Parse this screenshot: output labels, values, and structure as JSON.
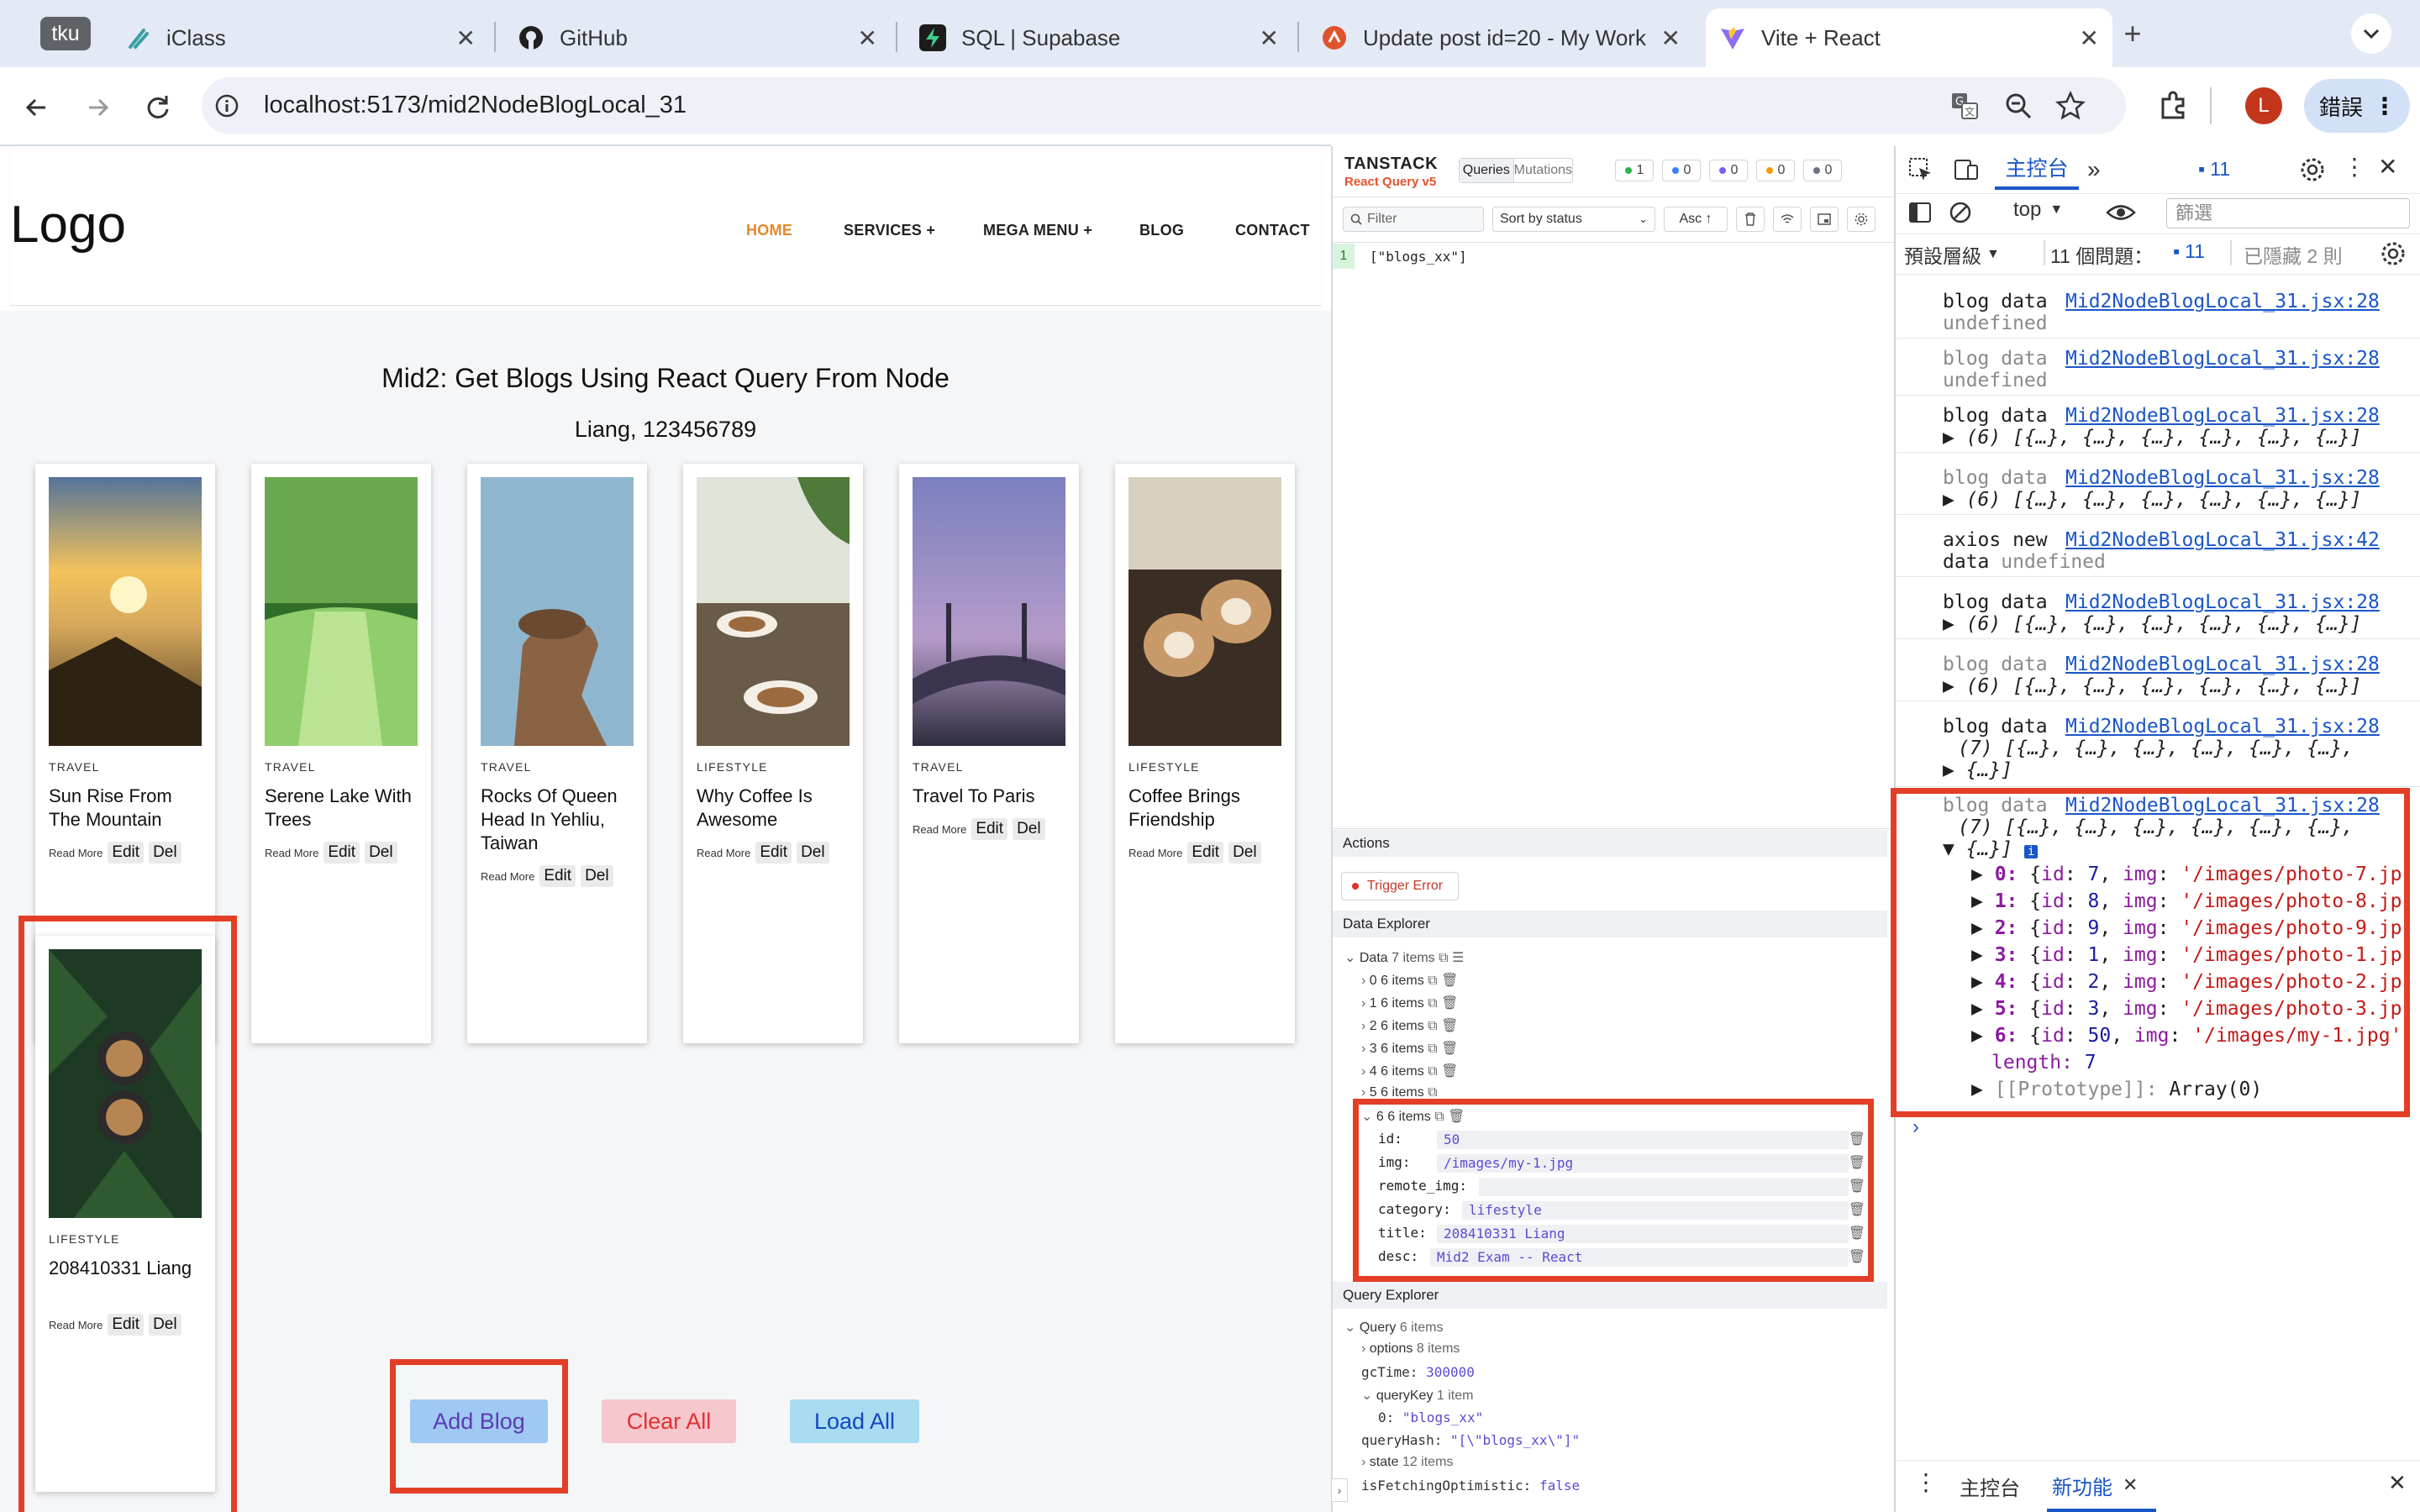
{
  "browser": {
    "tabs": [
      {
        "label": "iClass"
      },
      {
        "label": "GitHub"
      },
      {
        "label": "SQL | Supabase"
      },
      {
        "label": "Update post id=20 - My Work"
      },
      {
        "label": "Vite + React"
      }
    ],
    "profile_chip": "tku",
    "url": "localhost:5173/mid2NodeBlogLocal_31",
    "avatar_letter": "L",
    "error_label": "錯誤"
  },
  "site": {
    "logo": "Logo",
    "nav": [
      "HOME",
      "SERVICES +",
      "MEGA MENU +",
      "BLOG",
      "CONTACT"
    ],
    "heading": "Mid2: Get Blogs Using React Query From Node",
    "subheading": "Liang, 123456789",
    "read_more": "Read More",
    "edit_label": "Edit",
    "del_label": "Del",
    "cards": [
      {
        "category": "TRAVEL",
        "title": "Sun Rise From The Mountain"
      },
      {
        "category": "TRAVEL",
        "title": "Serene Lake With Trees"
      },
      {
        "category": "TRAVEL",
        "title": "Rocks Of Queen Head In Yehliu, Taiwan"
      },
      {
        "category": "LIFESTYLE",
        "title": "Why Coffee Is Awesome"
      },
      {
        "category": "TRAVEL",
        "title": "Travel To Paris"
      },
      {
        "category": "LIFESTYLE",
        "title": "Coffee Brings Friendship"
      },
      {
        "category": "LIFESTYLE",
        "title": "208410331 Liang"
      }
    ],
    "buttons": {
      "add": "Add Blog",
      "clear": "Clear All",
      "load": "Load All"
    }
  },
  "tanstack": {
    "brand": "TANSTACK",
    "sub": "React Query v5",
    "tabs": [
      "Queries",
      "Mutations"
    ],
    "counts": [
      "1",
      "0",
      "0",
      "0",
      "0"
    ],
    "filter_placeholder": "Filter",
    "sort": "Sort by status",
    "order": "Asc ↑",
    "query_index": "1",
    "query_key": "[\"blogs_xx\"]",
    "actions_title": "Actions",
    "trigger_error": "Trigger Error",
    "data_explorer_title": "Data Explorer",
    "data_root": "Data",
    "data_root_count": "7 items",
    "data_rows": [
      {
        "k": "0",
        "v": "6 items"
      },
      {
        "k": "1",
        "v": "6 items"
      },
      {
        "k": "2",
        "v": "6 items"
      },
      {
        "k": "3",
        "v": "6 items"
      },
      {
        "k": "4",
        "v": "6 items"
      },
      {
        "k": "5",
        "v": "6 items"
      }
    ],
    "expanded": {
      "k": "6",
      "v": "6 items"
    },
    "fields": [
      {
        "k": "id:",
        "v": "50"
      },
      {
        "k": "img:",
        "v": "/images/my-1.jpg"
      },
      {
        "k": "remote_img:",
        "v": ""
      },
      {
        "k": "category:",
        "v": "lifestyle"
      },
      {
        "k": "title:",
        "v": "208410331 Liang"
      },
      {
        "k": "desc:",
        "v": "Mid2 Exam -- React"
      }
    ],
    "query_explorer_title": "Query Explorer",
    "qe": {
      "query": "Query",
      "query_count": "6 items",
      "options": "options",
      "options_count": "8 items",
      "gcTime_k": "gcTime:",
      "gcTime_v": "300000",
      "queryKey": "queryKey",
      "queryKey_count": "1 item",
      "qk0_k": "0:",
      "qk0_v": "\"blogs_xx\"",
      "queryHash_k": "queryHash:",
      "queryHash_v": "\"[\\\"blogs_xx\\\"]\"",
      "state": "state",
      "state_count": "12 items",
      "fetching_k": "isFetchingOptimistic:",
      "fetching_v": "false"
    }
  },
  "devtools": {
    "tab_console": "主控台",
    "issue_badge": "11",
    "context": "top",
    "filter_placeholder": "篩選",
    "level": "預設層級",
    "issues_label": "11 個問題：",
    "issues_count": "11",
    "hidden": "已隱藏 2 則",
    "src28": "Mid2NodeBlogLocal_31.jsx:28",
    "src42": "Mid2NodeBlogLocal_31.jsx:42",
    "blog_data": "blog data",
    "undefined": "undefined",
    "axios_new": "axios new",
    "data_label": "data",
    "arr6": "(6) [{…}, {…}, {…}, {…}, {…}, {…}]",
    "arr7a": "(7) [{…}, {…}, {…}, {…}, {…}, {…},",
    "arr7b": "{…}]",
    "expanded_items": [
      {
        "i": "0:",
        "id": "7",
        "img": "'/images/photo-7.jp"
      },
      {
        "i": "1:",
        "id": "8",
        "img": "'/images/photo-8.jp"
      },
      {
        "i": "2:",
        "id": "9",
        "img": "'/images/photo-9.jp"
      },
      {
        "i": "3:",
        "id": "1",
        "img": "'/images/photo-1.jp"
      },
      {
        "i": "4:",
        "id": "2",
        "img": "'/images/photo-2.jp"
      },
      {
        "i": "5:",
        "id": "3",
        "img": "'/images/photo-3.jp"
      },
      {
        "i": "6:",
        "id": "50",
        "img": "'/images/my-1.jpg'"
      }
    ],
    "length_k": "length:",
    "length_v": "7",
    "prototype_k": "[[Prototype]]:",
    "prototype_v": "Array(0)",
    "drawer_tabs": [
      "主控台",
      "新功能"
    ]
  }
}
